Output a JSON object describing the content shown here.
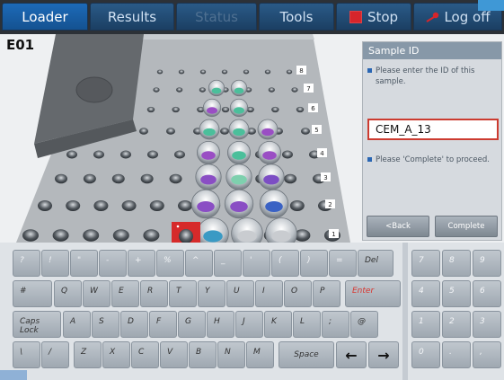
{
  "nav": {
    "tabs": [
      {
        "label": "Loader"
      },
      {
        "label": "Results"
      },
      {
        "label": "Status"
      },
      {
        "label": "Tools"
      },
      {
        "label": "Stop"
      },
      {
        "label": "Log off"
      }
    ]
  },
  "run_id": "E01",
  "tray": {
    "row_numbers": [
      "8",
      "7",
      "6",
      "5",
      "4",
      "3",
      "2",
      "1"
    ]
  },
  "panel": {
    "title": "Sample ID",
    "hint1": "Please enter the ID of this sample.",
    "sample_id_value": "CEM_A_13",
    "hint2": "Please 'Complete' to proceed.",
    "back_label": "<Back",
    "complete_label": "Complete"
  },
  "keyboard": {
    "row1": [
      "?",
      "!",
      "\"",
      "-",
      "+",
      "%",
      "^",
      "_",
      "'",
      "(",
      ")",
      "=",
      "Del"
    ],
    "row2": [
      "#",
      "Q",
      "W",
      "E",
      "R",
      "T",
      "Y",
      "U",
      "I",
      "O",
      "P",
      "Enter"
    ],
    "row3": [
      "Caps Lock",
      "A",
      "S",
      "D",
      "F",
      "G",
      "H",
      "J",
      "K",
      "L",
      ";",
      "@"
    ],
    "row4": [
      "\\",
      "/",
      "Z",
      "X",
      "C",
      "V",
      "B",
      "N",
      "M",
      "Space",
      "←",
      "→"
    ],
    "numpad": [
      "7",
      "8",
      "9",
      "4",
      "5",
      "6",
      "1",
      "2",
      "3",
      "0",
      ".",
      ","
    ]
  },
  "colors": {
    "accent": "#1d6ab8",
    "stop": "#d6252b",
    "field_border": "#cc3b30"
  }
}
